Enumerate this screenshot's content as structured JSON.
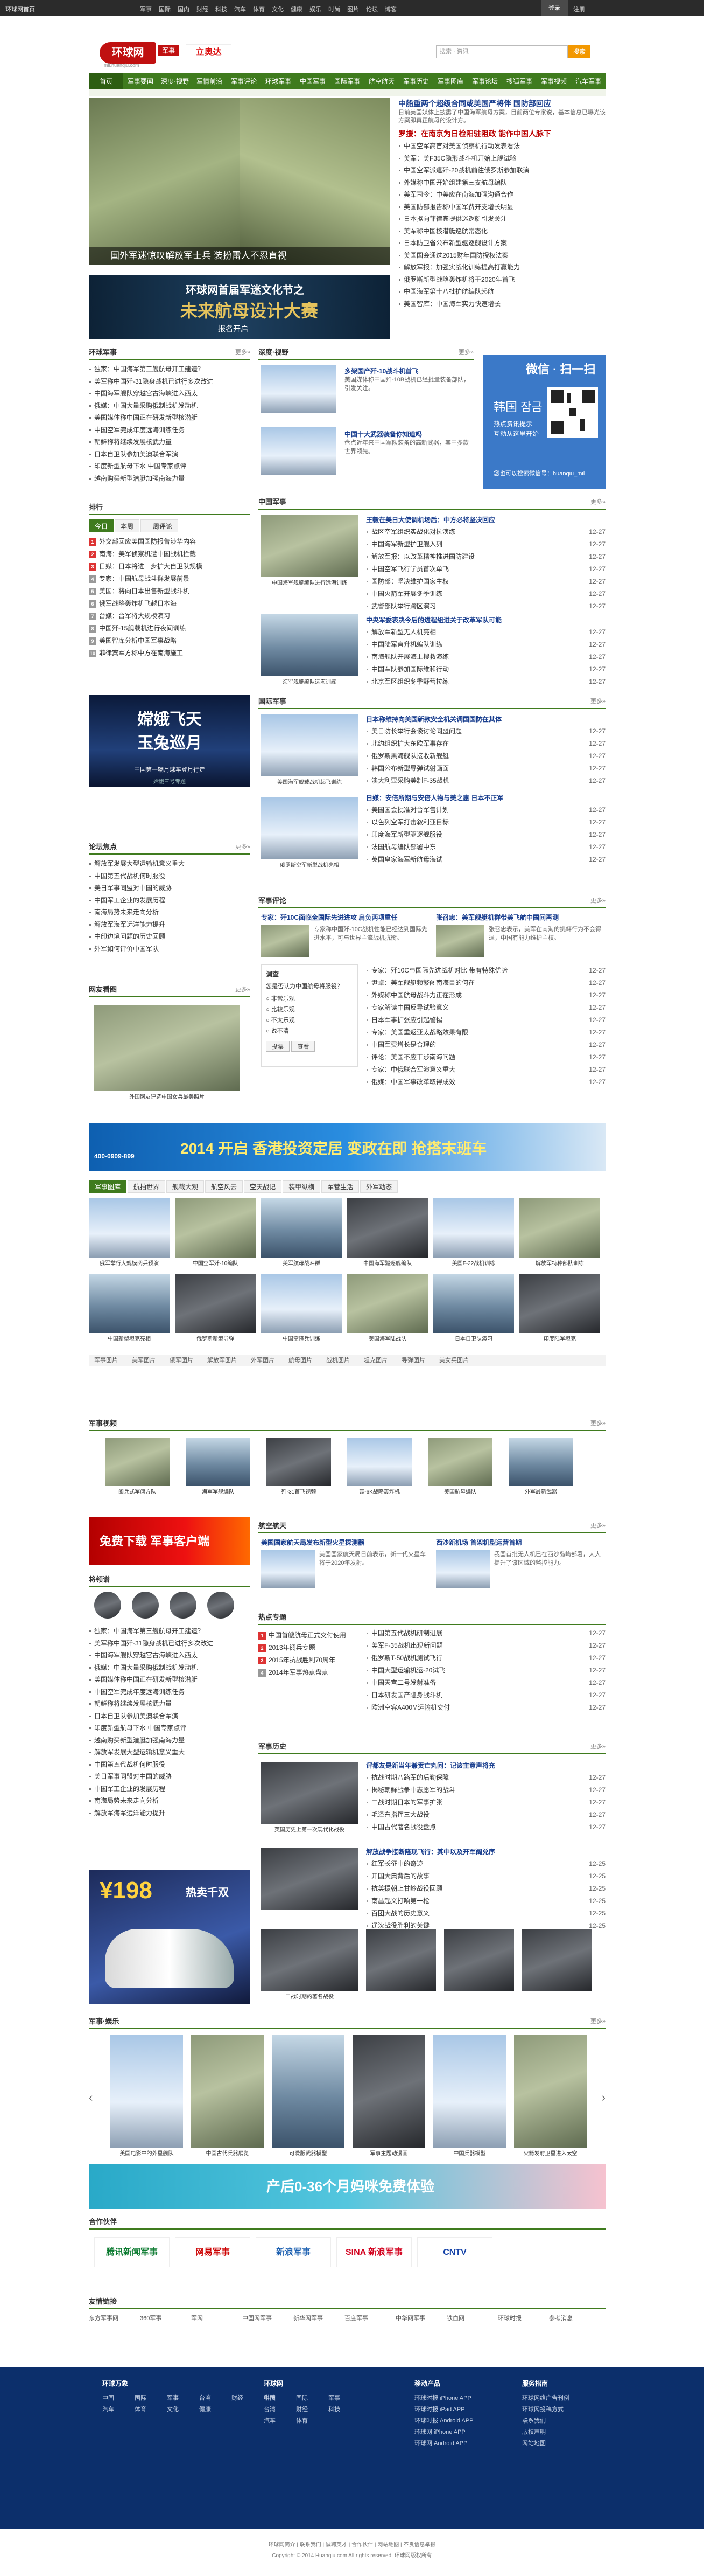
{
  "topbar": {
    "brand": "环球网首页",
    "nav": [
      "军事",
      "国际",
      "国内",
      "财经",
      "科技",
      "汽车",
      "体育",
      "文化",
      "健康",
      "娱乐",
      "时尚",
      "图片",
      "论坛",
      "博客"
    ],
    "login": "登录",
    "register": "注册"
  },
  "header": {
    "logo": "环球网",
    "tag": "军事",
    "sub": "mil.huanqiu.com",
    "ad": "立奥达",
    "search_placeholder": "搜索 · 资讯",
    "search_button": "搜索"
  },
  "nav": [
    "首页",
    "军事要闻",
    "深度·视野",
    "军情前沿",
    "军事评论",
    "环球军事",
    "中国军事",
    "国际军事",
    "航空航天",
    "军事历史",
    "军事图库",
    "军事论坛",
    "搜狐军事",
    "军事视频",
    "汽车军事"
  ],
  "slider": {
    "caption": "国外军迷惊叹解放军士兵 装扮雷人不忍直视"
  },
  "banner": {
    "l1": "环球网首届军迷文化节之",
    "l2": "未来航母设计大赛",
    "l3": "报名开启"
  },
  "headline": {
    "title": "中船重两个超级合同或美国严将伴 国防部回应",
    "desc": "日前美国媒体上披露了中国海军航母方案，目前两位专家说，基本信息已曝光该方案即真正航母的设计方。",
    "title2": "罗援：在南京为日检阳驻阻政 能作中国人脉下"
  },
  "headline_list": [
    "中国空军高官对美国侦察机行动发表看法",
    "美军：美F35C隐形战斗机开始上舰试验",
    "中国空军派遣歼-20战机前往俄罗斯参加联演",
    "外媒称中国开始组建第三支航母编队",
    "美军司令：中美应在南海加强沟通合作",
    "美国防部报告称中国军费开支增长明显",
    "日本拟向菲律宾提供巡逻艇引发关注",
    "美军称中国核潜艇巡航常态化",
    "日本防卫省公布新型驱逐舰设计方案",
    "美国国会通过2015财年国防授权法案",
    "解放军报：加强实战化训练提高打赢能力",
    "俄罗斯新型战略轰炸机将于2020年首飞",
    "中国海军第十八批护航编队起航",
    "美国智库：中国海军实力快速增长"
  ],
  "left1": {
    "title": "环球军事",
    "items": [
      "独家：中国海军第三艘航母开工建造？",
      "美军称中国歼-31隐身战机已进行多次改进",
      "中国海军舰队穿越宫古海峡进入西太",
      "俄媒：中国大量采购俄制战机发动机",
      "美国媒体称中国正在研发新型核潜艇",
      "中国空军完成年度远海训练任务",
      "朝鲜称将继续发展核武力量",
      "日本自卫队参加美澳联合军演",
      "印度新型航母下水 中国专家点评",
      "越南购买新型潜艇加强南海力量"
    ]
  },
  "left_rank": {
    "title": "排行",
    "tabs": [
      "今日",
      "本周",
      "一周评论"
    ],
    "items": [
      "外交部回应美国国防报告涉华内容",
      "南海：美军侦察机遭中国战机拦截",
      "日媒：日本将进一步扩大自卫队规模",
      "专家：中国航母战斗群发展前景",
      "美国：将向日本出售新型战斗机",
      "俄军战略轰炸机飞越日本海",
      "台媒：台军将大规模演习",
      "中国歼-15舰载机进行夜间训练",
      "美国智库分析中国军事战略",
      "菲律宾军方称中方在南海施工"
    ]
  },
  "deep": {
    "title": "深度·视野",
    "items": [
      {
        "title": "多架国产歼-10战斗机首飞",
        "desc": "美国媒体称中国歼-10B战机已经批量装备部队，引发关注。"
      },
      {
        "title": "中国十大武器装备你知道吗",
        "desc": "盘点近年来中国军队装备的高新武器，其中多款世界领先。"
      }
    ]
  },
  "wechat": {
    "title": "微信 · 扫一扫",
    "name": "韩国 잠금",
    "l1": "热点资讯提示",
    "l2": "互动从这里开始",
    "l3": "您也可以搜索微信号：huanqiu_mil"
  },
  "china": {
    "title": "中国军事",
    "pic": "中国海军舰艇编队进行远海训练",
    "h1": "王毅在美日大使调机场后：中方必将坚决回应",
    "items": [
      [
        "战区空军组织实战化对抗演练",
        "12-27"
      ],
      [
        "中国海军新型护卫舰入列",
        "12-27"
      ],
      [
        "解放军报：以改革精神推进国防建设",
        "12-27"
      ],
      [
        "中国空军飞行学员首次单飞",
        "12-27"
      ],
      [
        "国防部：坚决维护国家主权",
        "12-27"
      ],
      [
        "中国火箭军开展冬季训练",
        "12-27"
      ],
      [
        "武警部队举行跨区演习",
        "12-27"
      ]
    ],
    "h2": "中央军委表决今后的进程组进关于改革军队可能",
    "items2": [
      [
        "解放军新型无人机亮相",
        "12-27"
      ],
      [
        "中国陆军直升机编队训练",
        "12-27"
      ],
      [
        "南海舰队开展海上搜救演练",
        "12-27"
      ],
      [
        "中国军队参加国际维和行动",
        "12-27"
      ],
      [
        "北京军区组织冬季野营拉练",
        "12-27"
      ]
    ],
    "pic2": "海军舰艇编队远海训练"
  },
  "intl": {
    "title": "国际军事",
    "pic": "美国海军舰载战机起飞训练",
    "h1": "日本称维持向美国新款安全机关调国国防在其体",
    "items": [
      [
        "美日防长举行会谈讨论同盟问题",
        "12-27"
      ],
      [
        "北约组织扩大东欧军事存在",
        "12-27"
      ],
      [
        "俄罗斯黑海舰队接收新舰艇",
        "12-27"
      ],
      [
        "韩国公布新型导弹试射画面",
        "12-27"
      ],
      [
        "澳大利亚采购美制F-35战机",
        "12-27"
      ]
    ],
    "h2": "日媒：安倍所期与安倍人物与美之惠 日本不正军",
    "items2": [
      [
        "美国国会批准对台军售计划",
        "12-27"
      ],
      [
        "以色列空军打击叙利亚目标",
        "12-27"
      ],
      [
        "印度海军新型驱逐舰服役",
        "12-27"
      ],
      [
        "法国航母编队部署中东",
        "12-27"
      ],
      [
        "英国皇家海军新航母海试",
        "12-27"
      ]
    ],
    "pic2": "俄罗斯空军新型战机亮相"
  },
  "comment": {
    "title": "军事评论",
    "c1t": "专家：歼10C面临全国际先进进攻 肩负两项重任",
    "c1d": "专家称中国歼-10C战机性能已经达到国际先进水平，可与世界主流战机抗衡。",
    "c2t": "张召忠：美军舰艇机群带美飞航中国间再测",
    "c2d": "张召忠表示，美军在南海的挑衅行为不会得逞，中国有能力维护主权。",
    "items": [
      [
        "专家：歼10C与国际先进战机对比 带有特殊优势",
        "12-27"
      ],
      [
        "尹卓：美军舰艇频繁闯南海目的何在",
        "12-27"
      ],
      [
        "外媒称中国航母战斗力正在形成",
        "12-27"
      ],
      [
        "专家解读中国反导试验意义",
        "12-27"
      ],
      [
        "日本军事扩张应引起警惕",
        "12-27"
      ],
      [
        "专家：美国重返亚太战略效果有限",
        "12-27"
      ],
      [
        "中国军费增长是合理的",
        "12-27"
      ],
      [
        "评论：美国不应干涉南海问题",
        "12-27"
      ],
      [
        "专家：中俄联合军演意义重大",
        "12-27"
      ],
      [
        "俄媒：中国军事改革取得成效",
        "12-27"
      ]
    ]
  },
  "survey": {
    "title": "调查",
    "q": "您是否认为中国航母将服役？",
    "opts": [
      "非常乐观",
      "比较乐观",
      "不太乐观",
      "说不清"
    ],
    "btn1": "投票",
    "btn2": "查看"
  },
  "netfriends": {
    "title": "网友看图",
    "pic": "外国网友评选中国女兵最美照片"
  },
  "left2": {
    "title": "论坛焦点",
    "items": [
      "解放军发展大型运输机意义重大",
      "中国第五代战机何时服役",
      "美日军事同盟对中国的威胁",
      "中国军工企业的发展历程",
      "南海局势未来走向分析",
      "解放军海军远洋能力提升",
      "中印边境问题的历史回顾",
      "外军如何评价中国军队"
    ]
  },
  "moon": {
    "l1": "嫦娥飞天",
    "l2": "玉兔巡月",
    "l3": "中国第一辆月球车登月行走",
    "l4": "嫦娥三号专题"
  },
  "ad_wide": {
    "phone": "400-0909-899",
    "t": "2014 开启 香港投资定居 变政在即 抢搭末班车"
  },
  "gallery": {
    "tabs": [
      "军事图库",
      "航拍世界",
      "舰载大观",
      "航空风云",
      "空天战记",
      "装甲纵横",
      "军营生活",
      "外军动态"
    ],
    "pics": [
      "俄军举行大规模阅兵预演",
      "中国空军歼-10编队",
      "美军航母战斗群",
      "中国海军驱逐舰编队",
      "美国F-22战机训练",
      "解放军特种部队训练",
      "中国新型坦克亮相",
      "俄罗斯新型导弹",
      "中国空降兵训练",
      "美国海军陆战队",
      "日本自卫队演习",
      "印度陆军坦克"
    ],
    "subtabs": [
      "军事图片",
      "美军图片",
      "俄军图片",
      "解放军图片",
      "外军图片",
      "航母图片",
      "战机图片",
      "坦克图片",
      "导弹图片",
      "美女兵图片"
    ]
  },
  "photo_strip": {
    "title": "军事视频",
    "pics": [
      "阅兵式军旗方队",
      "海军军舰编队",
      "歼-31首飞视频",
      "轰-6K战略轰炸机",
      "美国航母编队",
      "外军最新武器"
    ]
  },
  "app_ad": {
    "t": "兔费下载 军事客户端"
  },
  "stars": {
    "title": "将领谱"
  },
  "hot": {
    "title": "热点专题",
    "items": [
      "中国首艘航母正式交付使用",
      "2013年阅兵专题",
      "2015年抗战胜利70周年",
      "2014年军事热点盘点"
    ]
  },
  "aviation": {
    "title": "航空航天",
    "c1t": "美国国家航天局发布新型火星探测器",
    "c1d": "美国国家航天局日前表示，新一代火星车将于2020年发射。",
    "c2t": "西沙新机场 首架机型运营首期",
    "c2d": "我国首批无人机已在西沙岛屿部署，大大提升了该区域的监控能力。",
    "items": [
      [
        "中国第五代战机研制进展",
        "12-27"
      ],
      [
        "美军F-35战机出现新问题",
        "12-27"
      ],
      [
        "俄罗斯T-50战机测试飞行",
        "12-27"
      ],
      [
        "中国大型运输机运-20试飞",
        "12-27"
      ],
      [
        "中国天宫二号发射准备",
        "12-27"
      ],
      [
        "日本研发国产隐身战斗机",
        "12-27"
      ],
      [
        "欧洲空客A400M运输机交付",
        "12-27"
      ]
    ]
  },
  "history": {
    "title": "军事历史",
    "h1": "评都友是新当年兼贡亡丸间：记该主意声将充",
    "items": [
      [
        "抗战时期八路军的后勤保障",
        "12-27"
      ],
      [
        "揭秘朝鲜战争中志愿军的战斗",
        "12-27"
      ],
      [
        "二战时期日本的军事扩张",
        "12-27"
      ],
      [
        "毛泽东指挥三大战役",
        "12-27"
      ],
      [
        "中国古代著名战役盘点",
        "12-27"
      ]
    ],
    "h2": "解放战争接断隆现飞行：其中以及开军阔兑序",
    "items2": [
      [
        "红军长征中的奇迹",
        "12-25"
      ],
      [
        "开国大典背后的故事",
        "12-25"
      ],
      [
        "抗美援朝上甘岭战役回顾",
        "12-25"
      ],
      [
        "南昌起义打响第一枪",
        "12-25"
      ],
      [
        "百团大战的历史意义",
        "12-25"
      ],
      [
        "辽沈战役胜利的关键",
        "12-25"
      ]
    ],
    "pic": "英国历史上第一次现代化战役",
    "pic2": "二战时期的著名战役"
  },
  "shoe_ad": {
    "price": "¥198",
    "t": "热卖千双"
  },
  "movies": {
    "title": "军事·娱乐",
    "pics": [
      "美国电影中的外星舰队",
      "中国古代兵器展览",
      "可爱版武器模型",
      "军事主题动漫画",
      "中国兵器模型",
      "火箭发射卫星进入太空"
    ]
  },
  "baby_ad": {
    "t": "产后0-36个月妈咪免费体验"
  },
  "partners": {
    "title": "合作伙伴",
    "items": [
      "腾讯新闻军事",
      "网易军事",
      "新浪军事",
      "SINA 新浪军事",
      "CNTV"
    ]
  },
  "links": {
    "title": "友情链接",
    "items": [
      "东方军事网",
      "360军事",
      "军网",
      "中国网军事",
      "新华网军事",
      "百度军事",
      "中华网军事",
      "铁血网",
      "环球时报",
      "参考消息"
    ]
  },
  "footer": {
    "col1": "环球万象",
    "col2": "环球网",
    "col3": "移动产品",
    "col4": "服务指南",
    "c1": [
      "中国",
      "国际",
      "军事",
      "台湾",
      "财经",
      "科技",
      "汽车",
      "体育",
      "文化",
      "健康"
    ],
    "c3": [
      "环球时报 iPhone APP",
      "环球时报 iPad APP",
      "环球时报 Android APP",
      "环球网 iPhone APP",
      "环球网 Android APP"
    ],
    "c4": [
      "环球网络广告刊例",
      "环球网投稿方式",
      "联系我们",
      "版权声明",
      "网站地图"
    ]
  },
  "bottom": {
    "l1": "环球网简介 | 联系我们 | 诚聘英才 | 合作伙伴 | 网站地图 | 不良信息举报",
    "l2": "Copyright © 2014 Huanqiu.com All rights reserved. 环球网版权所有"
  }
}
